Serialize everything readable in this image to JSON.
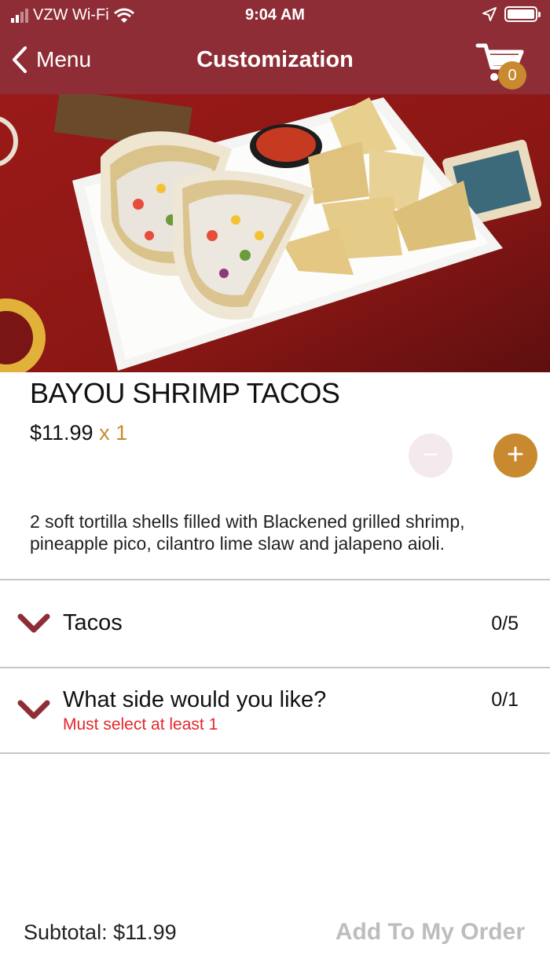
{
  "status_bar": {
    "carrier": "VZW Wi-Fi",
    "time": "9:04 AM"
  },
  "nav": {
    "back_label": "Menu",
    "title": "Customization",
    "cart_count": "0"
  },
  "item": {
    "name": "BAYOU SHRIMP TACOS",
    "price": "$11.99",
    "quantity": "x 1",
    "minus_label": "−",
    "plus_label": "+",
    "description": "2 soft tortilla shells filled with Blackened grilled shrimp, pineapple pico, cilantro lime slaw and jalapeno aioli."
  },
  "sections": [
    {
      "title": "Tacos",
      "count": "0/5",
      "warning": ""
    },
    {
      "title": "What side would you like?",
      "count": "0/1",
      "warning": "Must select at least 1"
    }
  ],
  "footer": {
    "subtotal": "Subtotal: $11.99",
    "add_button": "Add To My Order"
  },
  "colors": {
    "brand": "#8e2d35",
    "accent": "#c9892e",
    "warning": "#e5262b",
    "disabled": "#bdbdbd"
  }
}
